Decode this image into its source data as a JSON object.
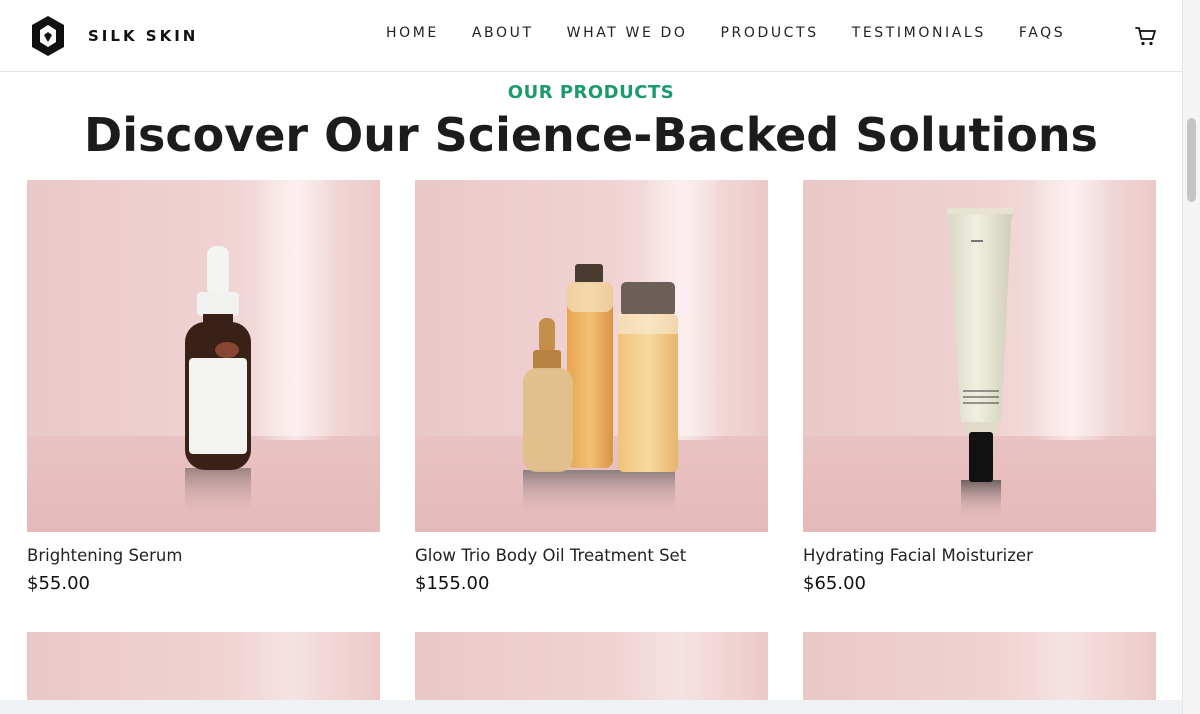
{
  "brand": {
    "name": "SILK SKIN",
    "logo_icon": "hexagon-logo-icon"
  },
  "nav": {
    "items": [
      {
        "label": "HOME"
      },
      {
        "label": "ABOUT"
      },
      {
        "label": "WHAT WE DO"
      },
      {
        "label": "PRODUCTS"
      },
      {
        "label": "TESTIMONIALS"
      },
      {
        "label": "FAQS"
      }
    ],
    "cart_icon": "shopping-cart-icon"
  },
  "section": {
    "eyebrow": "OUR PRODUCTS",
    "headline": "Discover Our Science-Backed Solutions"
  },
  "products": [
    {
      "name": "Brightening Serum",
      "price": "$55.00",
      "image": "dropper-bottle"
    },
    {
      "name": "Glow Trio Body Oil Treatment Set",
      "price": "$155.00",
      "image": "three-bottles"
    },
    {
      "name": "Hydrating Facial Moisturizer",
      "price": "$65.00",
      "image": "cream-tube"
    }
  ],
  "colors": {
    "accent": "#1d9a6c",
    "card_background": "#f0d2d2",
    "text": "#1c1c1c"
  }
}
